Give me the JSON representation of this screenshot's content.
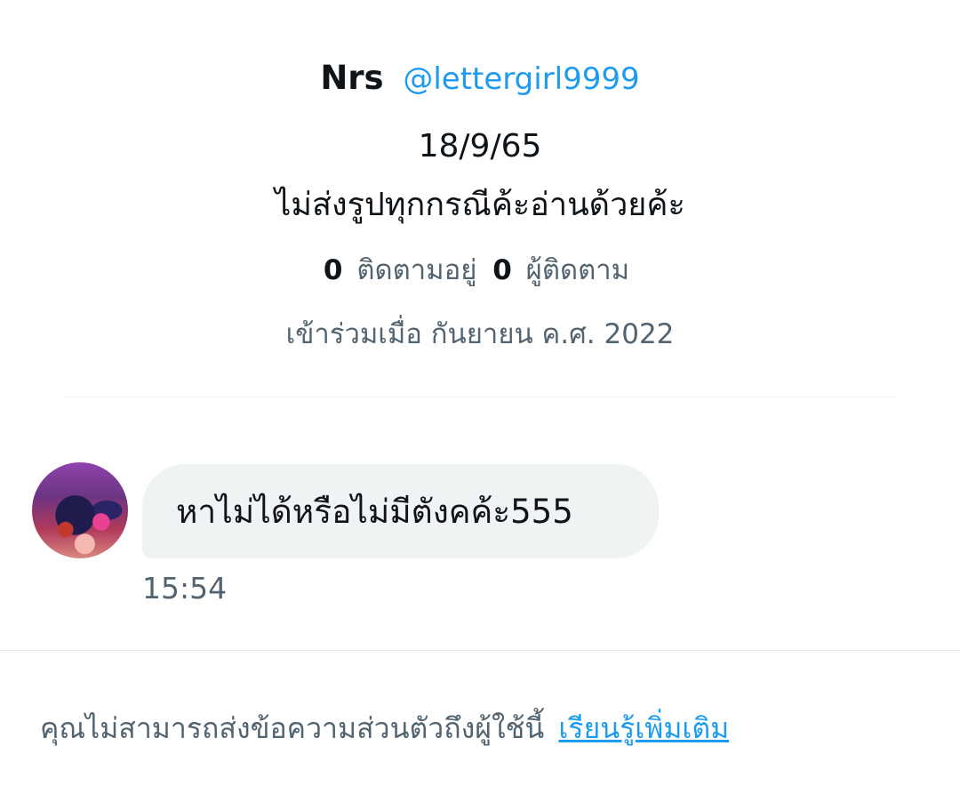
{
  "profile": {
    "display_name": "Nrs",
    "handle": "@lettergirl9999",
    "bio_line1": "18/9/65",
    "bio_line2": "ไม่ส่งรูปทุกกรณีค้ะอ่านด้วยค้ะ",
    "following_count": "0",
    "following_label": "ติดตามอยู่",
    "followers_count": "0",
    "followers_label": "ผู้ติดตาม",
    "joined": "เข้าร่วมเมื่อ กันยายน ค.ศ. 2022"
  },
  "message": {
    "avatar": "user-avatar",
    "text": "หาไม่ได้หรือไม่มีตังคค้ะ555",
    "time": "15:54"
  },
  "footer": {
    "notice": "คุณไม่สามารถส่งข้อความส่วนตัวถึงผู้ใช้นี้",
    "learn_more": "เรียนรู้เพิ่มเติม"
  },
  "colors": {
    "accent": "#1d9bf0",
    "secondary_text": "#536471",
    "bubble_bg": "#eff3f4"
  }
}
